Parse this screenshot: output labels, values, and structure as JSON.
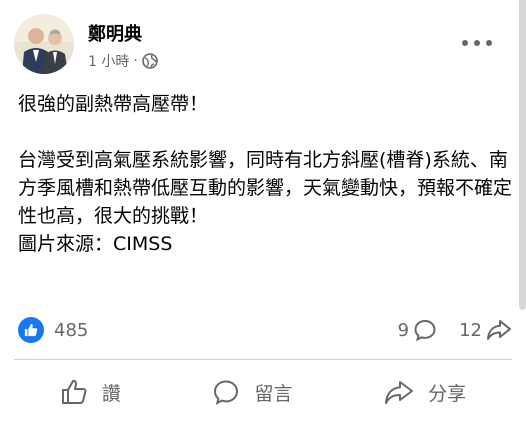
{
  "post": {
    "author": "鄭明典",
    "timestamp": "1 小時",
    "separator": "·",
    "privacy_icon": "globe-icon",
    "paragraphs": [
      "很強的副熱帶高壓帶！",
      "台灣受到高氣壓系統影響，同時有北方斜壓(槽脊)系統、南方季風槽和熱帶低壓互動的影響，天氣變動快，預報不確定性也高，很大的挑戰！",
      "圖片來源：CIMSS"
    ]
  },
  "stats": {
    "likes": "485",
    "comments": "9",
    "shares": "12"
  },
  "actions": {
    "like_label": "讚",
    "comment_label": "留言",
    "share_label": "分享"
  },
  "colors": {
    "accent": "#1877f2",
    "secondary_text": "#65676b"
  }
}
